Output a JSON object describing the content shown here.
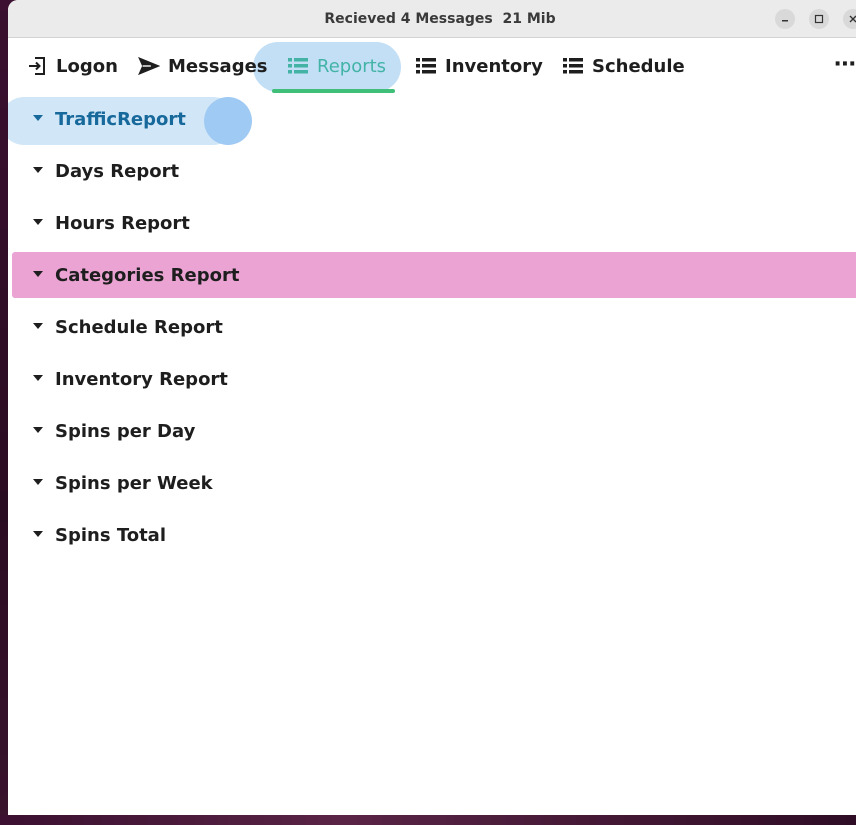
{
  "window": {
    "title": "Recieved 4 Messages  21 Mib",
    "buttons": [
      "minimize-icon",
      "maximize-icon",
      "close-icon"
    ]
  },
  "toolbar": {
    "tabs": [
      {
        "label": "Logon",
        "icon": "logon-icon",
        "active": false
      },
      {
        "label": "Messages",
        "icon": "send-icon",
        "active": false
      },
      {
        "label": "Reports",
        "icon": "list-icon",
        "active": true
      },
      {
        "label": "Inventory",
        "icon": "list-icon",
        "active": false
      },
      {
        "label": "Schedule",
        "icon": "list-icon",
        "active": false
      }
    ],
    "more_label": "⋯"
  },
  "reports": {
    "items": [
      {
        "label": "TrafficReport",
        "state": "focused"
      },
      {
        "label": "Days Report",
        "state": "normal"
      },
      {
        "label": "Hours Report",
        "state": "normal"
      },
      {
        "label": "Categories Report",
        "state": "selected"
      },
      {
        "label": "Schedule Report",
        "state": "normal"
      },
      {
        "label": "Inventory Report",
        "state": "normal"
      },
      {
        "label": "Spins per Day",
        "state": "normal"
      },
      {
        "label": "Spins per Week",
        "state": "normal"
      },
      {
        "label": "Spins Total",
        "state": "normal"
      }
    ]
  },
  "colors": {
    "active_tab_text": "#43b3a6",
    "active_tab_underline": "#3fbf77",
    "selected_row_bg": "#eba3d4",
    "focused_text": "#17699c",
    "highlight_blue": "#b7d9f4"
  }
}
